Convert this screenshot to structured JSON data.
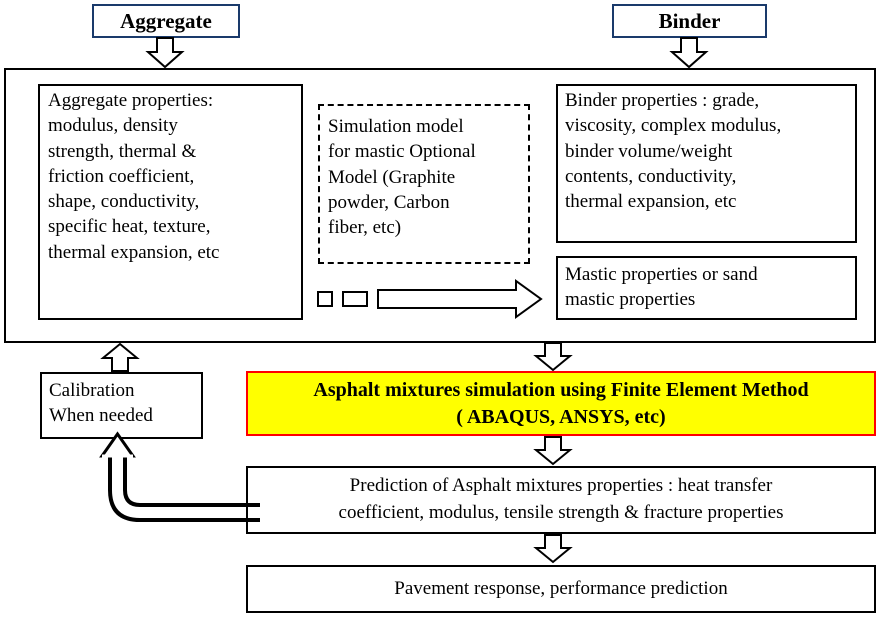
{
  "diagram": {
    "title": "Asphalt mixture simulation framework flowchart",
    "nodes": {
      "aggregate": "Aggregate",
      "binder": "Binder",
      "aggregate_properties": "Aggregate properties:\nmodulus, density\nstrength, thermal &\nfriction coefficient,\nshape, conductivity,\nspecific heat, texture,\nthermal expansion, etc",
      "simulation_model": "Simulation model\nfor mastic Optional\nModel (Graphite\npowder, Carbon\nfiber, etc)",
      "binder_properties": "Binder properties : grade,\nviscosity, complex modulus,\nbinder volume/weight\ncontents, conductivity,\nthermal expansion, etc",
      "mastic_properties": "Mastic properties or sand\nmastic properties",
      "calibration": "Calibration\nWhen needed",
      "simulation_fem_line1": "Asphalt mixtures simulation using Finite Element Method",
      "simulation_fem_line2": "( ABAQUS, ANSYS, etc)",
      "prediction_line1": "Prediction of Asphalt mixtures properties : heat transfer",
      "prediction_line2": "coefficient, modulus, tensile strength & fracture properties",
      "pavement_response": "Pavement response, performance prediction"
    },
    "colors": {
      "top_box_border": "#1a3a6b",
      "highlight_fill": "#ffff00",
      "highlight_border": "#ff0000",
      "default_border": "#000000",
      "background": "#ffffff"
    }
  }
}
